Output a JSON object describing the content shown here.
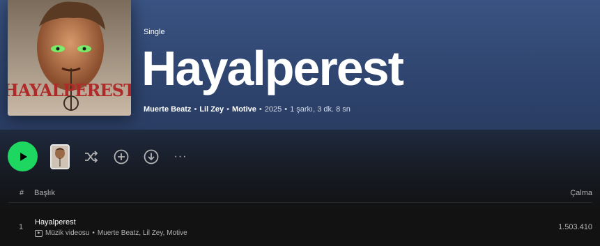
{
  "album": {
    "type_label": "Single",
    "title": "Hayalperest",
    "cover_text": "HAYALPEREST",
    "artists": [
      "Muerte Beatz",
      "Lil Zey",
      "Motive"
    ],
    "year": "2025",
    "summary": "1 şarkı, 3 dk. 8 sn",
    "hero_color": "#3a5382"
  },
  "actions": {
    "play": "play-icon",
    "shuffle": "shuffle-icon",
    "add": "add-circle-icon",
    "download": "download-icon",
    "more": "more-icon",
    "more_label": "···"
  },
  "table": {
    "headers": {
      "index": "#",
      "title": "Başlık",
      "plays": "Çalma"
    },
    "tracks": [
      {
        "index": "1",
        "title": "Hayalperest",
        "type": "Müzik videosu",
        "artists": "Muerte Beatz, Lil Zey, Motive",
        "plays": "1.503.410"
      }
    ]
  },
  "accent_color": "#1ed760"
}
